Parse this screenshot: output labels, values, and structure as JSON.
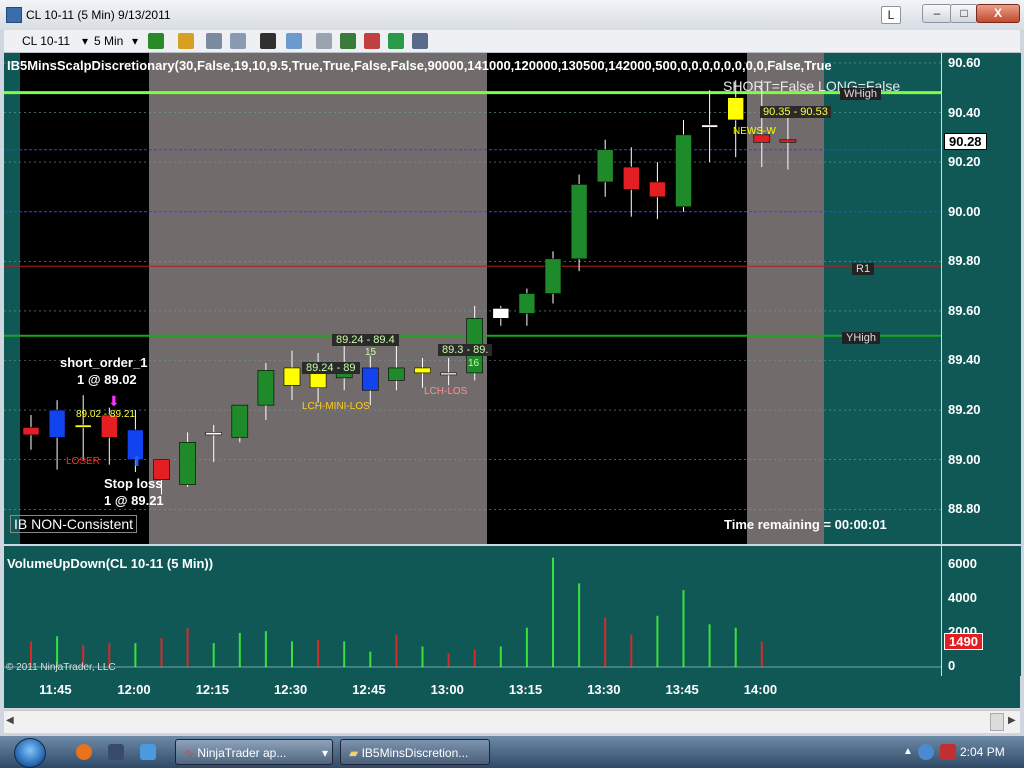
{
  "window": {
    "title": "CL 10-11 (5 Min)  9/13/2011",
    "button_l": "L",
    "minimize": "–",
    "maximize": "□",
    "close": "X"
  },
  "toolbar": {
    "instrument": "CL 10-11",
    "interval": "5 Min",
    "icons": [
      "bar-type-icon",
      "drawing-pencil-icon",
      "pin-icon",
      "line-icon",
      "crosshair-icon",
      "zoom-icon",
      "properties-icon",
      "strategy-icon",
      "chart-trader-icon",
      "dollar-icon",
      "template-icon"
    ]
  },
  "chart_top": {
    "indicator_title": "IB5MinsScalpDiscretionary(30,False,19,10,9.5,True,True,False,False,90000,141000,120000,130500,142000,500,0,0,0,0,0,0,0,0,False,True",
    "status": "SHORT=False LONG=False",
    "price_ticks": [
      "90.60",
      "90.40",
      "90.20",
      "90.00",
      "89.80",
      "89.60",
      "89.40",
      "89.20",
      "89.00",
      "88.80"
    ],
    "current_price": "90.28",
    "labels": {
      "whigh": "WHigh",
      "r1": "R1",
      "yhigh": "YHigh",
      "short_order": "short_order_1",
      "short_qty": "1 @ 89.02",
      "stop_loss": "Stop loss",
      "stop_qty": "1 @ 89.21",
      "loser": "LOSER",
      "range1": "89.24 - 89.4",
      "range1_count": "15",
      "range2": "89.3 - 89.",
      "range2_count": "16",
      "range3": "89.24 - 89",
      "mini_range": "89.02 - 89.21",
      "lch_los": "LCH-LOS",
      "lch_mini_los": "LCH-MINI-LOS",
      "news": "NEWS-W",
      "news_range": "90.35 - 90.53",
      "ib_status": "IB NON-Consistent",
      "time_remaining": "Time remaining = 00:00:01"
    }
  },
  "volume": {
    "title": "VolumeUpDown(CL 10-11 (5 Min))",
    "ticks": [
      "6000",
      "4000",
      "2000",
      "0"
    ],
    "current": "1490",
    "copyright": "© 2011 NinjaTrader, LLC"
  },
  "time_axis": [
    "11:45",
    "12:00",
    "12:15",
    "12:30",
    "12:45",
    "13:00",
    "13:15",
    "13:30",
    "13:45",
    "14:00"
  ],
  "chart_data": {
    "type": "candlestick",
    "title": "CL 10-11 (5 Min)",
    "x": [
      "11:40",
      "11:45",
      "11:50",
      "11:55",
      "12:00",
      "12:05",
      "12:10",
      "12:15",
      "12:20",
      "12:25",
      "12:30",
      "12:35",
      "12:40",
      "12:45",
      "12:50",
      "12:55",
      "13:00",
      "13:05",
      "13:10",
      "13:15",
      "13:20",
      "13:25",
      "13:30",
      "13:35",
      "13:40",
      "13:45",
      "13:50",
      "13:55",
      "14:00",
      "14:05"
    ],
    "open": [
      89.13,
      89.09,
      89.14,
      89.09,
      89.12,
      88.92,
      88.9,
      89.1,
      89.09,
      89.22,
      89.3,
      89.36,
      89.33,
      89.28,
      89.32,
      89.35,
      89.35,
      89.35,
      89.57,
      89.59,
      89.67,
      89.81,
      90.12,
      90.18,
      90.12,
      90.02,
      90.34,
      90.37,
      90.31,
      90.29
    ],
    "high": [
      89.18,
      89.24,
      89.26,
      89.21,
      89.2,
      88.99,
      89.11,
      89.14,
      89.22,
      89.39,
      89.44,
      89.43,
      89.46,
      89.42,
      89.47,
      89.41,
      89.41,
      89.62,
      89.62,
      89.69,
      89.84,
      90.15,
      90.29,
      90.26,
      90.2,
      90.37,
      90.49,
      90.53,
      90.53,
      90.38
    ],
    "low": [
      89.04,
      88.96,
      89.0,
      88.98,
      88.95,
      88.86,
      88.89,
      88.99,
      89.07,
      89.16,
      89.24,
      89.23,
      89.28,
      89.22,
      89.28,
      89.29,
      89.3,
      89.32,
      89.54,
      89.54,
      89.63,
      89.76,
      90.06,
      89.98,
      89.97,
      90.0,
      90.2,
      90.22,
      90.18,
      90.17
    ],
    "close": [
      89.1,
      89.2,
      89.13,
      89.18,
      89.0,
      89.0,
      89.07,
      89.11,
      89.22,
      89.36,
      89.37,
      89.29,
      89.37,
      89.37,
      89.37,
      89.37,
      89.35,
      89.57,
      89.61,
      89.67,
      89.81,
      90.11,
      90.25,
      90.09,
      90.06,
      90.31,
      90.35,
      90.46,
      90.28,
      90.28
    ],
    "colors": [
      "red",
      "blue",
      "yellow",
      "red",
      "blue",
      "red",
      "green",
      "white",
      "green",
      "green",
      "yellow",
      "yellow",
      "green",
      "blue",
      "green",
      "yellow",
      "white",
      "green",
      "white",
      "green",
      "green",
      "green",
      "green",
      "red",
      "red",
      "green",
      "white",
      "yellow",
      "red",
      "red"
    ],
    "volume": [
      1500,
      1800,
      1300,
      1400,
      1400,
      1700,
      2300,
      1400,
      2000,
      2100,
      1500,
      1600,
      1500,
      900,
      1900,
      1200,
      800,
      1000,
      1200,
      2300,
      6400,
      4900,
      2900,
      1900,
      3000,
      4500,
      2500,
      2300,
      1490,
      0
    ],
    "volume_up": [
      false,
      true,
      false,
      false,
      true,
      false,
      false,
      true,
      true,
      true,
      true,
      false,
      true,
      true,
      false,
      true,
      false,
      false,
      true,
      true,
      true,
      true,
      false,
      false,
      true,
      true,
      true,
      true,
      false,
      false
    ],
    "ylim": [
      88.66,
      90.64
    ],
    "volume_ylim": [
      0,
      6500
    ],
    "levels": {
      "whigh": 90.48,
      "r1": 89.78,
      "yhigh": 89.5,
      "blue_dash_1": 90.25,
      "blue_dash_2": 90.0
    },
    "colors_hex": {
      "up": "#1f8a2a",
      "down": "#e41f24",
      "blue": "#1144ee",
      "yellow": "#ffff00",
      "neutral": "#ffffff",
      "vol_up": "#39e13a",
      "vol_down": "#d62a24"
    }
  }
}
